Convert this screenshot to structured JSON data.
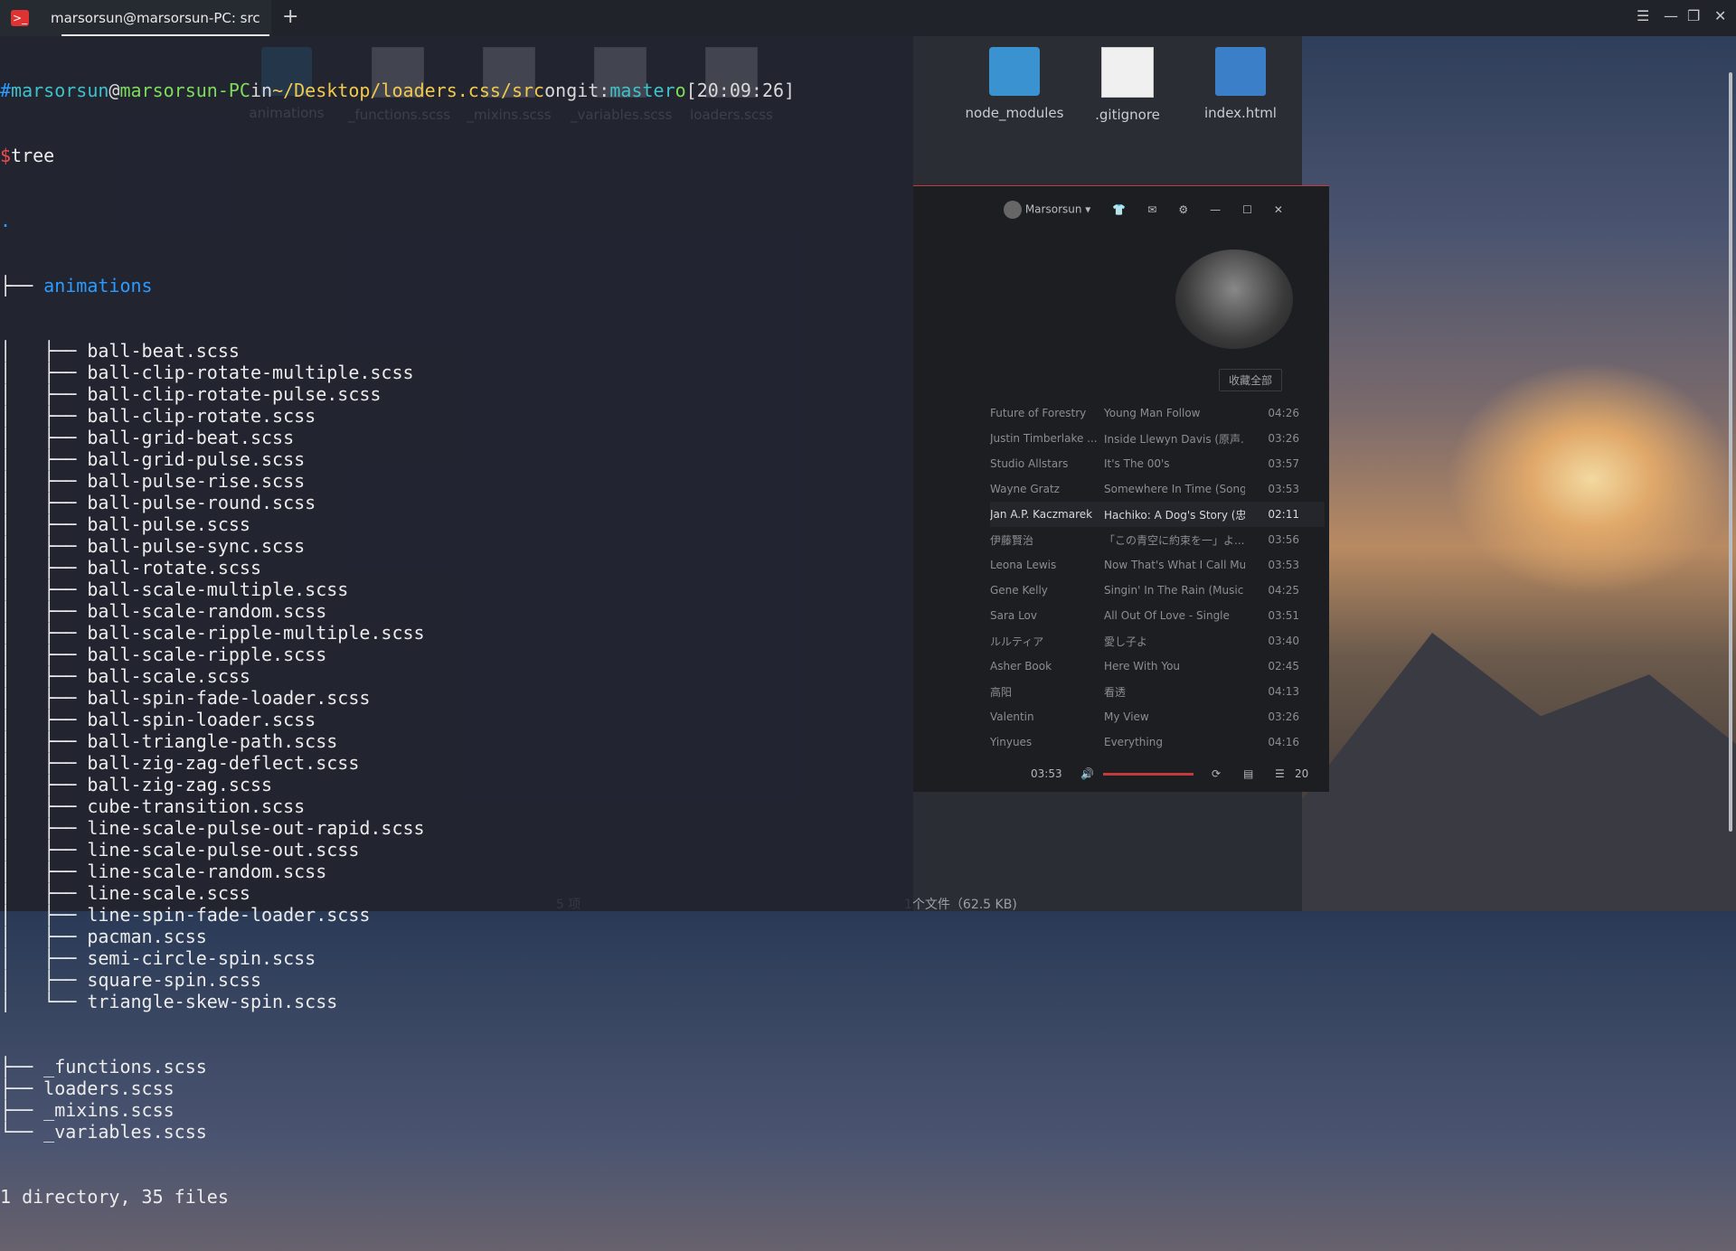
{
  "window": {
    "tab_title": "marsorsun@marsorsun-PC: src",
    "add_tab_icon": "plus-icon"
  },
  "prompt": {
    "hash": "#",
    "user": "marsorsun",
    "at": "@",
    "host": "marsorsun-PC",
    "in": "in",
    "path": "~/Desktop/loaders.css/src",
    "on": "on",
    "git_label": "git:",
    "branch": "master",
    "status": "o",
    "time": "[20:09:26]",
    "dollar": "$",
    "command": "tree"
  },
  "tree": {
    "root": ".",
    "dir": "animations",
    "files": [
      "ball-beat.scss",
      "ball-clip-rotate-multiple.scss",
      "ball-clip-rotate-pulse.scss",
      "ball-clip-rotate.scss",
      "ball-grid-beat.scss",
      "ball-grid-pulse.scss",
      "ball-pulse-rise.scss",
      "ball-pulse-round.scss",
      "ball-pulse.scss",
      "ball-pulse-sync.scss",
      "ball-rotate.scss",
      "ball-scale-multiple.scss",
      "ball-scale-random.scss",
      "ball-scale-ripple-multiple.scss",
      "ball-scale-ripple.scss",
      "ball-scale.scss",
      "ball-spin-fade-loader.scss",
      "ball-spin-loader.scss",
      "ball-triangle-path.scss",
      "ball-zig-zag-deflect.scss",
      "ball-zig-zag.scss",
      "cube-transition.scss",
      "line-scale-pulse-out-rapid.scss",
      "line-scale-pulse-out.scss",
      "line-scale-random.scss",
      "line-scale.scss",
      "line-spin-fade-loader.scss",
      "pacman.scss",
      "semi-circle-spin.scss",
      "square-spin.scss",
      "triangle-skew-spin.scss"
    ],
    "root_files": [
      "_functions.scss",
      "loaders.scss",
      "_mixins.scss",
      "_variables.scss"
    ],
    "summary": "1 directory, 35 files"
  },
  "file_manager": {
    "items": [
      {
        "name": "animations",
        "kind": "folder"
      },
      {
        "name": "_functions.scss",
        "kind": "file"
      },
      {
        "name": "_mixins.scss",
        "kind": "file"
      },
      {
        "name": "_variables.scss",
        "kind": "file"
      },
      {
        "name": "loaders.scss",
        "kind": "file"
      }
    ],
    "items_right": [
      {
        "name": "node_modules",
        "kind": "folder"
      },
      {
        "name": ".gitignore",
        "kind": "file"
      },
      {
        "name": "index.html",
        "kind": "html"
      }
    ],
    "status_left": "5 项",
    "status_right": "1个文件（62.5 KB)"
  },
  "player": {
    "user": "Marsorsun",
    "collect_all": "收藏全部",
    "tracks": [
      {
        "artist": "Future of Forestry",
        "song": "Young Man Follow",
        "dur": "04:26"
      },
      {
        "artist": "Justin Timberlake ...",
        "song": "Inside Llewyn Davis (原声...",
        "dur": "03:26"
      },
      {
        "artist": "Studio Allstars",
        "song": "It's The 00's",
        "dur": "03:57"
      },
      {
        "artist": "Wayne Gratz",
        "song": "Somewhere In Time (Song...",
        "dur": "03:53"
      },
      {
        "artist": "Jan A.P. Kaczmarek",
        "song": "Hachiko: A Dog's Story (忠...",
        "dur": "02:11",
        "active": true
      },
      {
        "artist": "伊藤賢治",
        "song": "「この青空に約束を一」よ...",
        "dur": "03:56"
      },
      {
        "artist": "Leona Lewis",
        "song": "Now That's What I Call Mu...",
        "dur": "03:53"
      },
      {
        "artist": "Gene Kelly",
        "song": "Singin' In The Rain (Music ...",
        "dur": "04:25"
      },
      {
        "artist": "Sara Lov",
        "song": "All Out Of Love - Single",
        "dur": "03:51"
      },
      {
        "artist": "ルルティア",
        "song": "愛し子よ",
        "dur": "03:40"
      },
      {
        "artist": "Asher Book",
        "song": "Here With You",
        "dur": "02:45"
      },
      {
        "artist": "高阳",
        "song": "看透",
        "dur": "04:13"
      },
      {
        "artist": "Valentin",
        "song": "My View",
        "dur": "03:26"
      },
      {
        "artist": "Yinyues",
        "song": "Everything",
        "dur": "04:16"
      }
    ],
    "time": "03:53",
    "playlist_count": "20"
  }
}
